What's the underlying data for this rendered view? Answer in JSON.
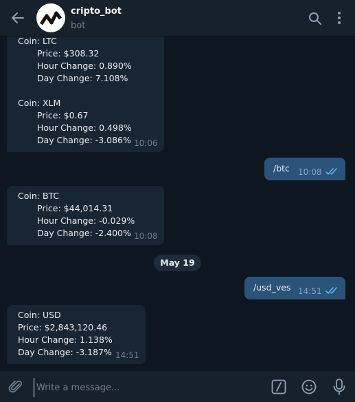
{
  "header": {
    "title": "cripto_bot",
    "subtitle": "bot",
    "avatar_icon": "chart-logo-icon"
  },
  "messages": {
    "m1": {
      "lines": [
        "Coin: LTC",
        "Price: $308.32",
        "Hour Change: 0.890%",
        "Day Change: 7.108%",
        "",
        "Coin: XLM",
        "Price: $0.67",
        "Hour Change: 0.498%",
        "Day Change: -3.086%"
      ],
      "time": "10:06"
    },
    "m2": {
      "text": "/btc",
      "time": "10:08"
    },
    "m3": {
      "lines": [
        "Coin: BTC",
        "Price: $44,014.31",
        "Hour Change: -0.029%",
        "Day Change: -2.400%"
      ],
      "time": "10:08"
    },
    "date_separator": "May 19",
    "m4": {
      "text": "/usd_ves",
      "time": "14:51"
    },
    "m5": {
      "lines": [
        "Coin: USD",
        "Price: $2,843,120.46",
        "Hour Change: 1.138%",
        "Day Change: -3.187%"
      ],
      "time": "14:51"
    }
  },
  "composer": {
    "placeholder": "Write a message...",
    "value": ""
  },
  "colors": {
    "background": "#0e1621",
    "header": "#17212b",
    "incoming_bubble": "#182533",
    "outgoing_bubble": "#2b5278",
    "read_checks": "#5fb4ef"
  }
}
